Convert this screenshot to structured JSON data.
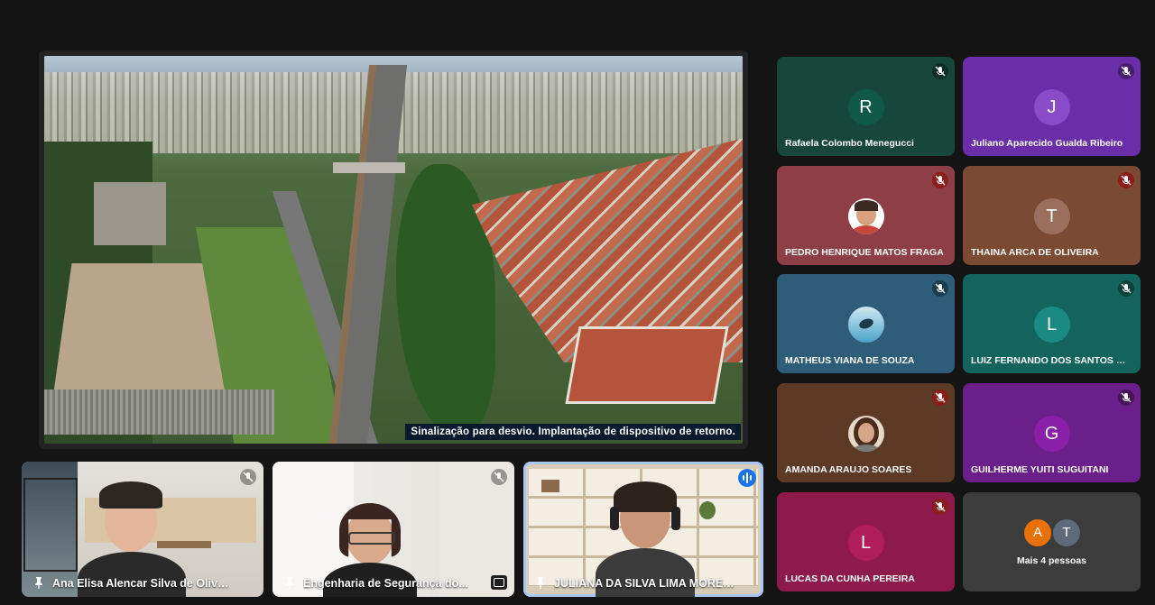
{
  "presentation": {
    "caption": "Sinalização para desvio. Implantação de dispositivo de retorno."
  },
  "participants": [
    {
      "name": "Rafaela Colombo Menegucci",
      "initial": "R",
      "tile_color": "#17473b",
      "avatar_color": "#0f5a47",
      "mic": "muted"
    },
    {
      "name": "Juliano Aparecido Gualda Ribeiro",
      "initial": "J",
      "tile_color": "#6a2fa8",
      "avatar_color": "#8a4bc9",
      "mic": "muted"
    },
    {
      "name": "PEDRO HENRIQUE MATOS FRAGA",
      "initial": "",
      "tile_color": "#8e3e47",
      "avatar_color": "#ffffff",
      "mic": "muted-red"
    },
    {
      "name": "THAINA ARCA DE OLIVEIRA",
      "initial": "T",
      "tile_color": "#7b4a33",
      "avatar_color": "#9a6f5d",
      "mic": "muted-red"
    },
    {
      "name": "MATHEUS VIANA DE SOUZA",
      "initial": "",
      "tile_color": "#2d5d78",
      "avatar_color": "#7fc0dc",
      "mic": "muted"
    },
    {
      "name": "LUIZ FERNANDO DOS SANTOS GA...",
      "initial": "L",
      "tile_color": "#14645e",
      "avatar_color": "#1a8a82",
      "mic": "muted"
    },
    {
      "name": "AMANDA ARAUJO SOARES",
      "initial": "",
      "tile_color": "#5c3a26",
      "avatar_color": "#e8d8c8",
      "mic": "muted-red"
    },
    {
      "name": "GUILHERME YUITI SUGUITANI",
      "initial": "G",
      "tile_color": "#6b1f8a",
      "avatar_color": "#8a1fa8",
      "mic": "muted"
    },
    {
      "name": "LUCAS DA CUNHA PEREIRA",
      "initial": "L",
      "tile_color": "#8e1a4c",
      "avatar_color": "#b01e5a",
      "mic": "muted-red"
    }
  ],
  "more": {
    "label": "Mais 4 pessoas",
    "initials": [
      "A",
      "T"
    ],
    "colors": [
      "#e8710a",
      "#5f6b7a"
    ]
  },
  "video_tiles": [
    {
      "name": "Ana Elisa Alencar Silva de Oliveira",
      "icon": "mic-off-icon"
    },
    {
      "name": "Engenharia de Segurança do...",
      "icon": "mic-off-icon"
    },
    {
      "name": "JULIANA DA SILVA LIMA MOREIRA",
      "icon": "speaking-icon"
    }
  ]
}
